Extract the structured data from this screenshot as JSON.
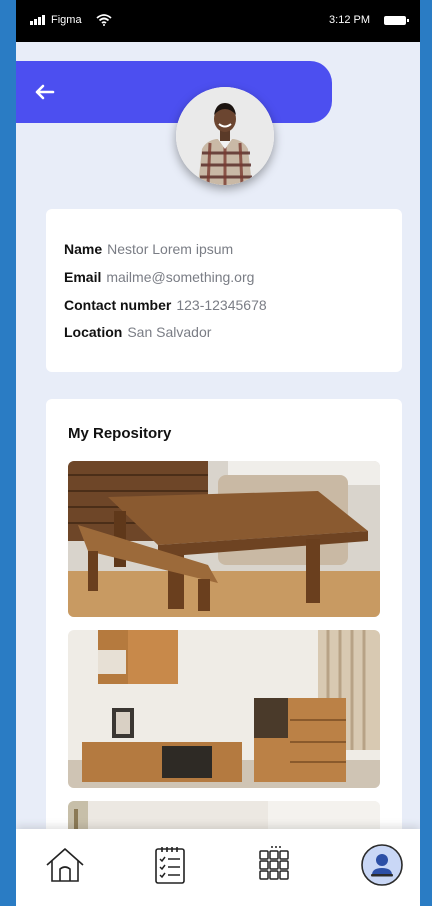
{
  "status_bar": {
    "carrier": "Figma",
    "time": "3:12 PM"
  },
  "profile": {
    "fields": [
      {
        "label": "Name",
        "value": "Nestor Lorem ipsum"
      },
      {
        "label": "Email",
        "value": "mailme@something.org"
      },
      {
        "label": "Contact number",
        "value": "123-12345678"
      },
      {
        "label": "Location",
        "value": "San Salvador"
      }
    ]
  },
  "repository": {
    "title": "My Repository"
  },
  "nav": {
    "items": [
      "home-icon",
      "checklist-icon",
      "grid-icon",
      "profile-icon"
    ],
    "active": "profile-icon"
  },
  "colors": {
    "accent": "#4c4ff0",
    "background": "#e8edf8"
  }
}
